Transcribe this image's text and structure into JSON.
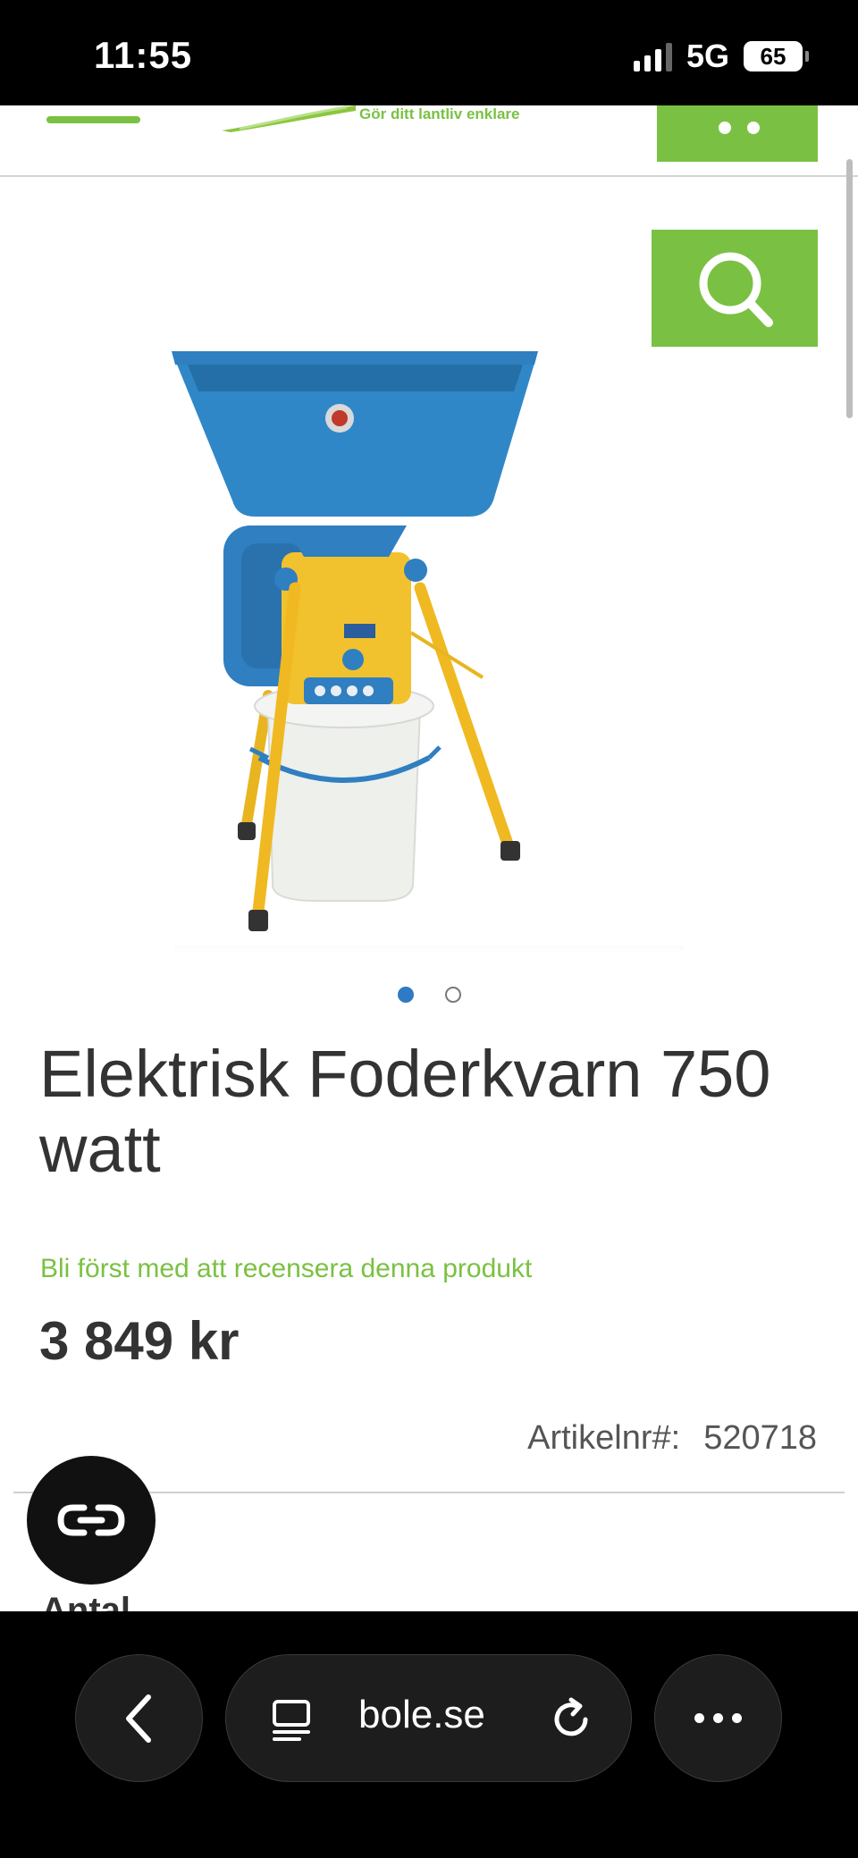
{
  "status_bar": {
    "time": "11:55",
    "network": "5G",
    "battery": "65"
  },
  "header": {
    "tagline": "Gör ditt lantliv enklare",
    "menu_icon": "hamburger-menu-icon",
    "cart_icon": "shopping-cart-icon",
    "accent_color": "#7ac143"
  },
  "gallery": {
    "search_icon": "magnifier-icon",
    "slide_count": 2,
    "active_slide": 1
  },
  "product": {
    "title": "Elektrisk Foderkvarn 750 watt",
    "review_link": "Bli först med att recensera denna produkt",
    "price": "3 849 kr",
    "sku_label": "Artikelnr#:",
    "sku_value": "520718",
    "quantity_label": "Antal"
  },
  "chat": {
    "icon": "chat-link-icon"
  },
  "browser": {
    "url": "bole.se",
    "back_icon": "chevron-left-icon",
    "page_icon": "page-menu-icon",
    "reload_icon": "reload-icon",
    "more_icon": "more-dots-icon"
  }
}
